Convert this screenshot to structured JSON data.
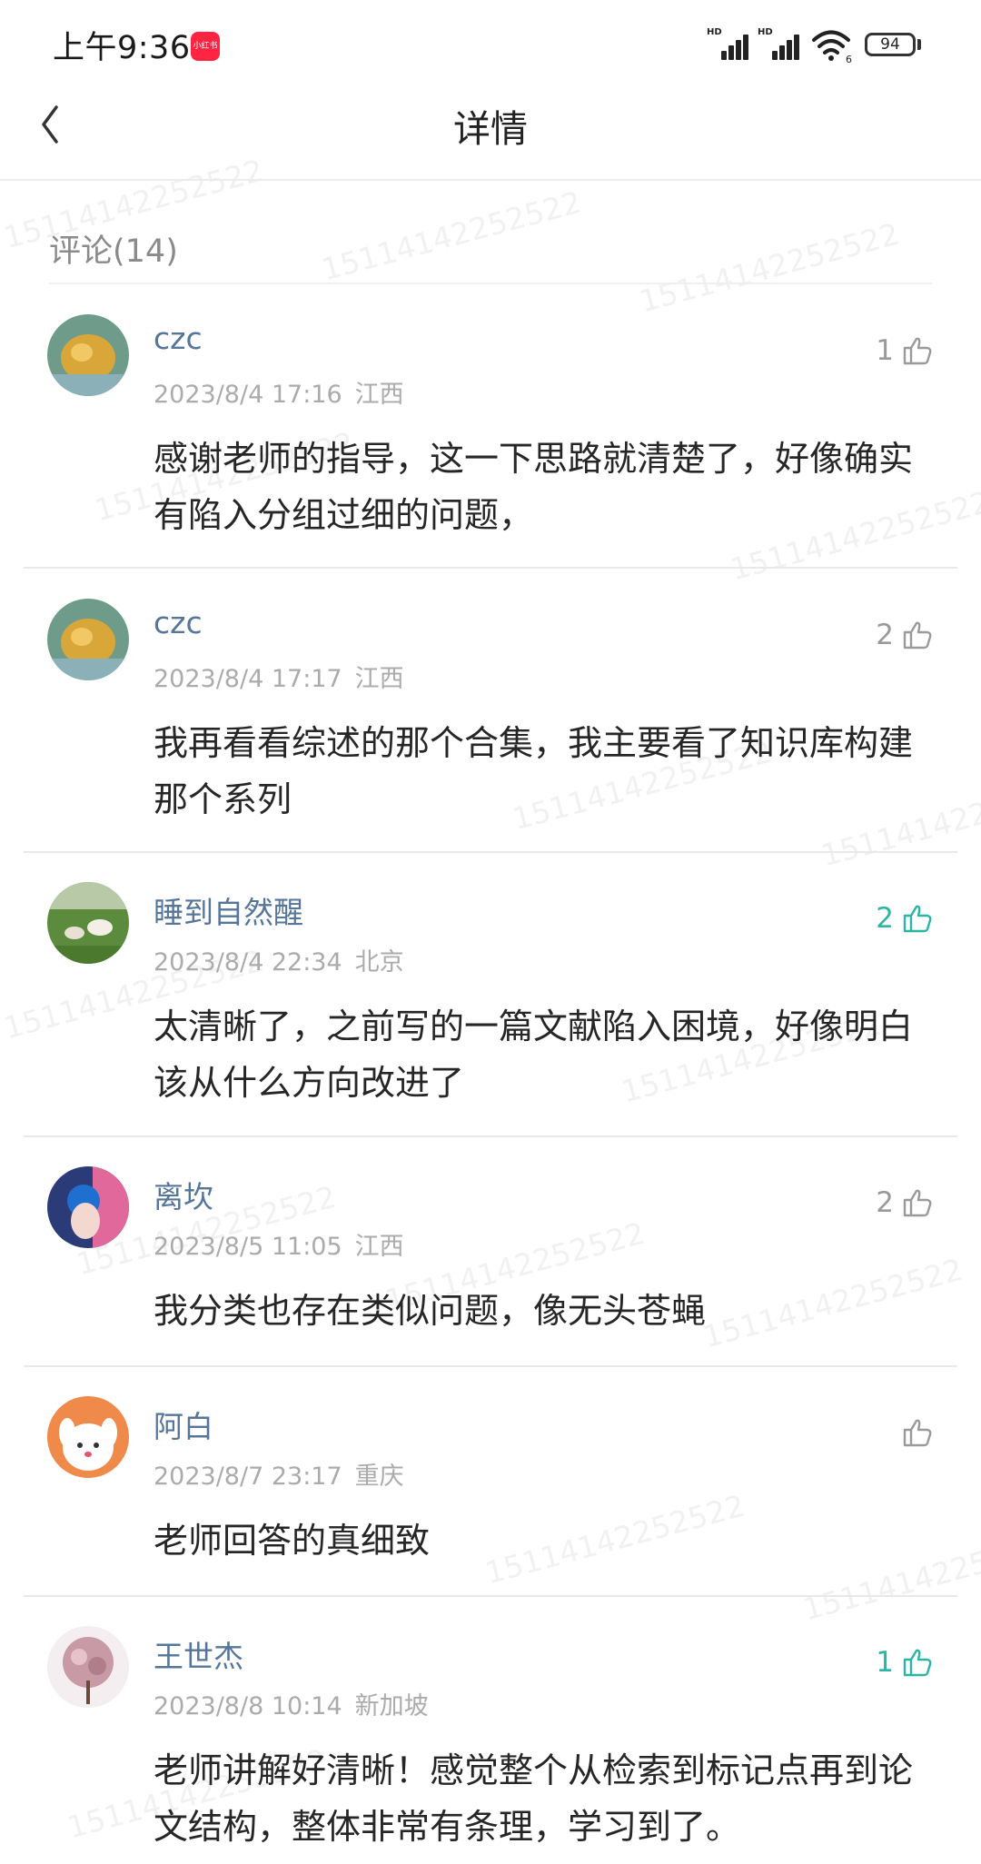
{
  "status": {
    "time": "上午9:36",
    "app_badge": "小红书",
    "battery": "94",
    "signal1_label": "HD",
    "signal2_label": "HD"
  },
  "header": {
    "title": "详情"
  },
  "comments_section": {
    "count_label": "评论(14)"
  },
  "comments": [
    {
      "name": "czc",
      "time": "2023/8/4 17:16",
      "location": "江西",
      "text": "感谢老师的指导，这一下思路就清楚了，好像确实有陷入分组过细的问题，",
      "likes": "1",
      "liked": false
    },
    {
      "name": "czc",
      "time": "2023/8/4 17:17",
      "location": "江西",
      "text": "我再看看综述的那个合集，我主要看了知识库构建那个系列",
      "likes": "2",
      "liked": false
    },
    {
      "name": "睡到自然醒",
      "time": "2023/8/4 22:34",
      "location": "北京",
      "text": "太清晰了，之前写的一篇文献陷入困境，好像明白该从什么方向改进了",
      "likes": "2",
      "liked": true
    },
    {
      "name": "离坎",
      "time": "2023/8/5 11:05",
      "location": "江西",
      "text": "我分类也存在类似问题，像无头苍蝇",
      "likes": "2",
      "liked": false
    },
    {
      "name": "阿白",
      "time": "2023/8/7 23:17",
      "location": "重庆",
      "text": "老师回答的真细致",
      "likes": "",
      "liked": false
    },
    {
      "name": "王世杰",
      "time": "2023/8/8 10:14",
      "location": "新加坡",
      "text": "老师讲解好清晰！感觉整个从检索到标记点再到论文结构，整体非常有条理，学习到了。",
      "likes": "1",
      "liked": true
    }
  ],
  "watermark": "15114142252522",
  "colors": {
    "name": "#56759b",
    "liked": "#2bb5a3",
    "meta": "#ababab"
  }
}
